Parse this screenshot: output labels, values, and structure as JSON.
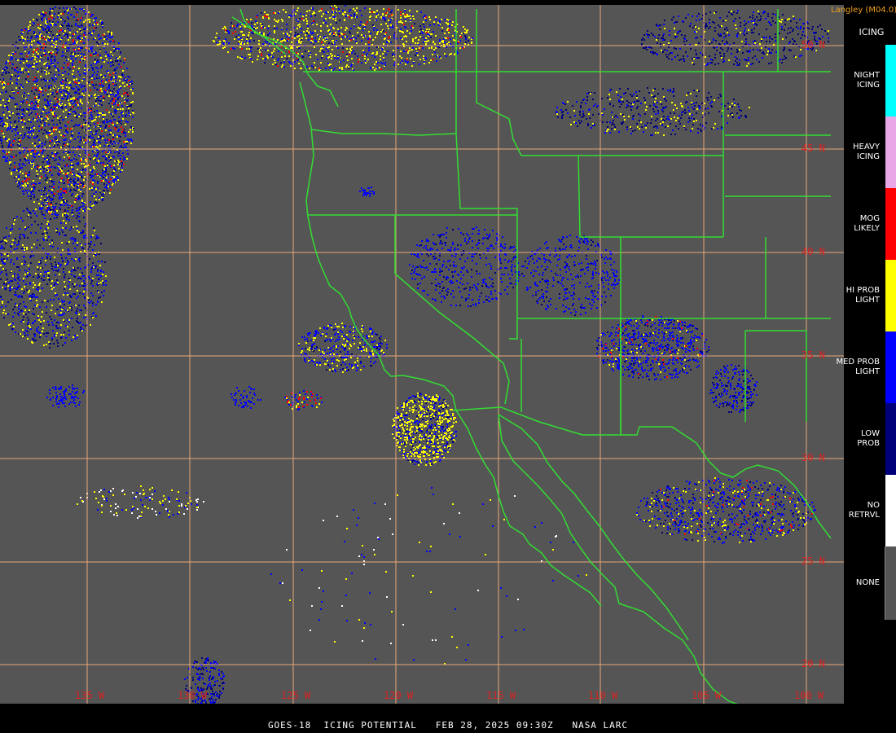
{
  "credit": "Langley (M04.0)",
  "legend": {
    "title": "ICING",
    "items": [
      {
        "label": "NIGHT\nICING",
        "color": "#00ffff"
      },
      {
        "label": "HEAVY\nICING",
        "color": "#e8a8e8"
      },
      {
        "label": "MOG\nLIKELY",
        "color": "#ff0000"
      },
      {
        "label": "HI PROB\nLIGHT",
        "color": "#ffff00"
      },
      {
        "label": "MED PROB\nLIGHT",
        "color": "#0000ff"
      },
      {
        "label": "LOW\nPROB",
        "color": "#00007a"
      },
      {
        "label": "NO\nRETRVL",
        "color": "#ffffff"
      },
      {
        "label": "NONE",
        "color": "#555555"
      }
    ]
  },
  "grid": {
    "latitudes": [
      "50 N",
      "45 N",
      "40 N",
      "35 N",
      "30 N",
      "25 N",
      "20 N"
    ],
    "longitudes": [
      "135 W",
      "130 W",
      "125 W",
      "120 W",
      "115 W",
      "110 W",
      "105 W",
      "100 W"
    ]
  },
  "footer": "GOES-18  ICING POTENTIAL   FEB 28, 2025 09:30Z   NASA LARC",
  "colors": {
    "grid": "#e8a878",
    "border": "#33dd33",
    "none": "#555555",
    "background": "#000000"
  }
}
